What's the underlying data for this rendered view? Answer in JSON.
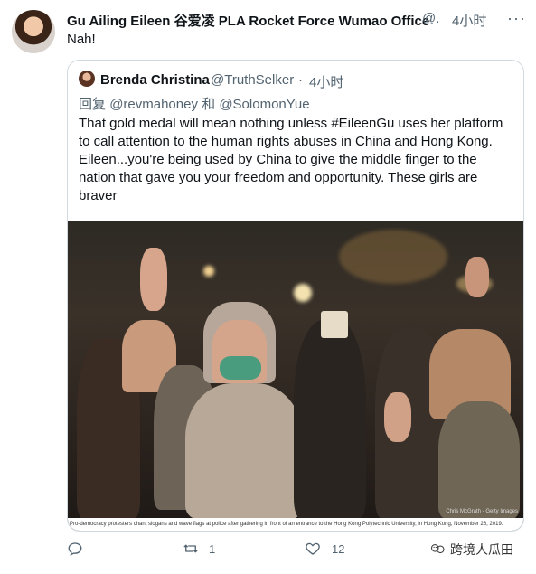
{
  "tweet": {
    "name": "Gu Ailing Eileen 谷爱凌 PLA Rocket Force Wumao Office",
    "handle": "@.",
    "dot": "·",
    "time": "4小时",
    "text": "Nah!"
  },
  "quote": {
    "name": "Brenda Christina",
    "handle": "@TruthSelker",
    "dot": "·",
    "time": "4小时",
    "reply_prefix": "回复",
    "reply_user1": "@revmahoney",
    "reply_and": "和",
    "reply_user2": "@SolomonYue",
    "body": "That gold medal will mean nothing unless #EileenGu uses her platform to call attention to the human rights abuses in China and Hong Kong. Eileen...you're being used by China to give the middle finger to the nation that gave you your freedom and opportunity. These girls are braver",
    "photo_caption": "Pro-democracy protesters chant slogans and wave flags at police after gathering in front of an entrance to the Hong Kong Polytechnic University, in Hong Kong, November 26, 2019.",
    "photo_credit": "Chris McGrath - Getty Images"
  },
  "actions": {
    "reply_count": "",
    "retweet_count": "1",
    "like_count": "12"
  },
  "watermark": "跨境人瓜田"
}
